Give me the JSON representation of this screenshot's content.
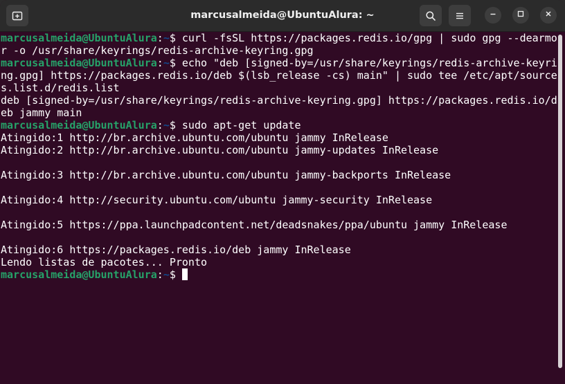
{
  "window": {
    "title": "marcusalmeida@UbuntuAlura: ~",
    "new_tab_icon": "new-tab-icon",
    "search_icon": "search-icon",
    "menu_icon": "hamburger-menu-icon",
    "minimize_icon": "minimize-icon",
    "maximize_icon": "maximize-icon",
    "close_icon": "close-icon"
  },
  "terminal": {
    "prompt": {
      "user_host": "marcusalmeida@UbuntuAlura",
      "colon": ":",
      "path": "~",
      "symbol": "$ "
    },
    "lines": [
      {
        "type": "prompt",
        "text": "curl -fsSL https://packages.redis.io/gpg | sudo gpg --dearmo"
      },
      {
        "type": "output",
        "text": "r -o /usr/share/keyrings/redis-archive-keyring.gpg"
      },
      {
        "type": "prompt",
        "text": "echo \"deb [signed-by=/usr/share/keyrings/redis-archive-keyri"
      },
      {
        "type": "output",
        "text": "ng.gpg] https://packages.redis.io/deb $(lsb_release -cs) main\" | sudo tee /etc/apt/source"
      },
      {
        "type": "output",
        "text": "s.list.d/redis.list"
      },
      {
        "type": "output",
        "text": "deb [signed-by=/usr/share/keyrings/redis-archive-keyring.gpg] https://packages.redis.io/d"
      },
      {
        "type": "output",
        "text": "eb jammy main"
      },
      {
        "type": "prompt",
        "text": "sudo apt-get update"
      },
      {
        "type": "output",
        "text": "Atingido:1 http://br.archive.ubuntu.com/ubuntu jammy InRelease"
      },
      {
        "type": "output",
        "text": "Atingido:2 http://br.archive.ubuntu.com/ubuntu jammy-updates InRelease"
      },
      {
        "type": "output",
        "text": ""
      },
      {
        "type": "output",
        "text": "Atingido:3 http://br.archive.ubuntu.com/ubuntu jammy-backports InRelease"
      },
      {
        "type": "output",
        "text": ""
      },
      {
        "type": "output",
        "text": "Atingido:4 http://security.ubuntu.com/ubuntu jammy-security InRelease"
      },
      {
        "type": "output",
        "text": ""
      },
      {
        "type": "output",
        "text": "Atingido:5 https://ppa.launchpadcontent.net/deadsnakes/ppa/ubuntu jammy InRelease"
      },
      {
        "type": "output",
        "text": ""
      },
      {
        "type": "output",
        "text": "Atingido:6 https://packages.redis.io/deb jammy InRelease"
      },
      {
        "type": "output",
        "text": "Lendo listas de pacotes... Pronto"
      },
      {
        "type": "prompt",
        "text": ""
      }
    ]
  },
  "colors": {
    "background": "#300a24",
    "titlebar": "#2b2b2b",
    "prompt_user": "#26a269",
    "prompt_path": "#12488b",
    "text": "#ffffff"
  }
}
